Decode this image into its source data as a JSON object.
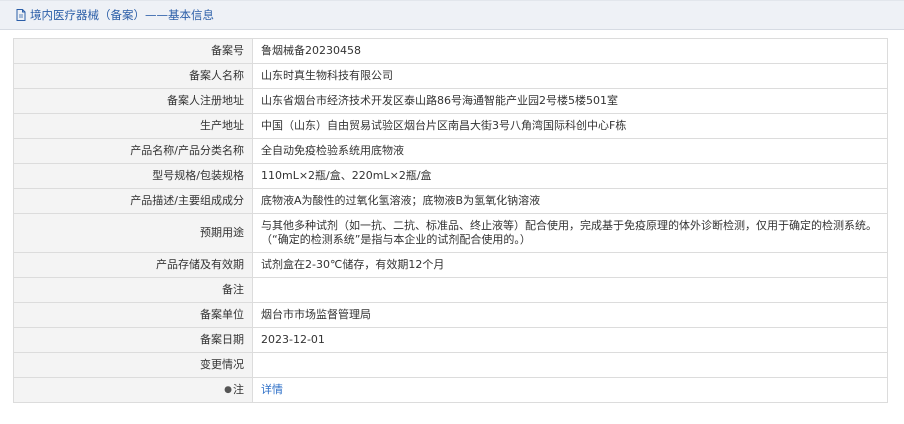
{
  "header": {
    "icon": "document-icon",
    "title": "境内医疗器械（备案）——基本信息"
  },
  "rows": [
    {
      "label": "备案号",
      "value": "鲁烟械备20230458"
    },
    {
      "label": "备案人名称",
      "value": "山东时真生物科技有限公司"
    },
    {
      "label": "备案人注册地址",
      "value": "山东省烟台市经济技术开发区泰山路86号海通智能产业园2号楼5楼501室"
    },
    {
      "label": "生产地址",
      "value": "中国（山东）自由贸易试验区烟台片区南昌大街3号八角湾国际科创中心F栋"
    },
    {
      "label": "产品名称/产品分类名称",
      "value": "全自动免疫检验系统用底物液"
    },
    {
      "label": "型号规格/包装规格",
      "value": "110mL×2瓶/盒、220mL×2瓶/盒"
    },
    {
      "label": "产品描述/主要组成成分",
      "value": "底物液A为酸性的过氧化氢溶液；底物液B为氢氧化钠溶液"
    },
    {
      "label": "预期用途",
      "value_line1": "与其他多种试剂（如一抗、二抗、标准品、终止液等）配合使用，完成基于免疫原理的体外诊断检测，仅用于确定的检测系统。",
      "value_line2": "（“确定的检测系统”是指与本企业的试剂配合使用的。）"
    },
    {
      "label": "产品存储及有效期",
      "value": "试剂盒在2-30℃储存，有效期12个月"
    },
    {
      "label": "备注",
      "value": ""
    },
    {
      "label": "备案单位",
      "value": "烟台市市场监督管理局"
    },
    {
      "label": "备案日期",
      "value": "2023-12-01"
    },
    {
      "label": "变更情况",
      "value": ""
    },
    {
      "label": "注",
      "label_icon": "note-icon",
      "value": "详情"
    }
  ]
}
